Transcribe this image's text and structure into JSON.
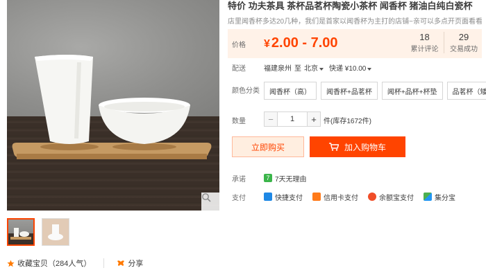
{
  "product": {
    "title": "特价 功夫茶具 茶杯品茗杯陶瓷小茶杯 闻香杯 猪油白纯白瓷杯",
    "subtitle": "店里闻香杯多达20几种，我们是首家以闻香杯为主打的店铺~亲可以多点开页面看看"
  },
  "price": {
    "label": "价格",
    "currency": "¥",
    "range": "2.00 - 7.00",
    "color": "#ff4400"
  },
  "stats": [
    {
      "value": "18",
      "label": "累计评论"
    },
    {
      "value": "29",
      "label": "交易成功"
    }
  ],
  "delivery": {
    "label": "配送",
    "from": "福建泉州",
    "to_word": "至",
    "to": "北京",
    "method": "快递 ¥10.00"
  },
  "color": {
    "label": "颜色分类",
    "options": [
      "闻香杯（高）",
      "闻香杯+品茗杯",
      "闻杯+品杯+杯垫",
      "品茗杯（矮）"
    ]
  },
  "quantity": {
    "label": "数量",
    "value": "1",
    "minus": "−",
    "plus": "+",
    "stock": "件(库存1672件)"
  },
  "buttons": {
    "buy_now": "立即购买",
    "add_cart": "加入购物车"
  },
  "promise": {
    "label": "承诺",
    "items": [
      "7天无理由"
    ]
  },
  "payment": {
    "label": "支付",
    "methods": [
      "快捷支付",
      "信用卡支付",
      "余额宝支付",
      "集分宝"
    ]
  },
  "footer": {
    "favorite": "收藏宝贝（284人气）",
    "share": "分享"
  },
  "icons": {
    "promise": "7-day-return-icon",
    "pay": [
      "quick-pay-icon",
      "credit-card-icon",
      "yuebao-icon",
      "jifenbao-icon"
    ]
  }
}
